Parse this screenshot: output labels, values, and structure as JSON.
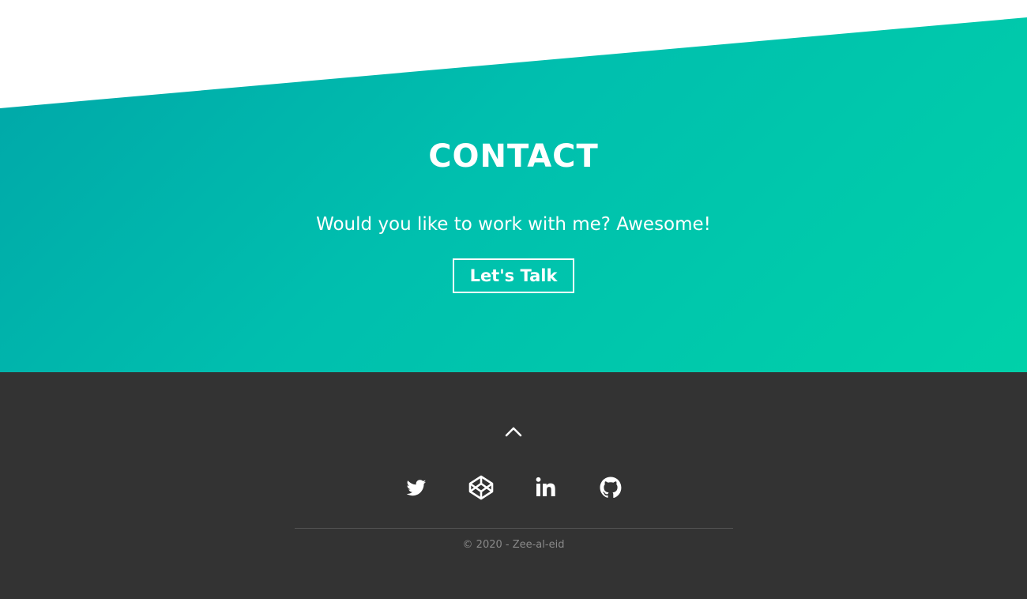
{
  "contact": {
    "title": "CONTACT",
    "subtitle": "Would you like to work with me? Awesome!",
    "button_label": "Let's Talk",
    "gradient_start": "#00a5a8",
    "gradient_end": "#00d1a9"
  },
  "footer": {
    "background": "#333333",
    "back_to_top_icon": "chevron-up-icon",
    "socials": [
      {
        "name": "twitter",
        "icon": "twitter-icon"
      },
      {
        "name": "codepen",
        "icon": "codepen-icon"
      },
      {
        "name": "linkedin",
        "icon": "linkedin-icon"
      },
      {
        "name": "github",
        "icon": "github-icon"
      }
    ],
    "copyright": "© 2020 - Zee-al-eid"
  }
}
